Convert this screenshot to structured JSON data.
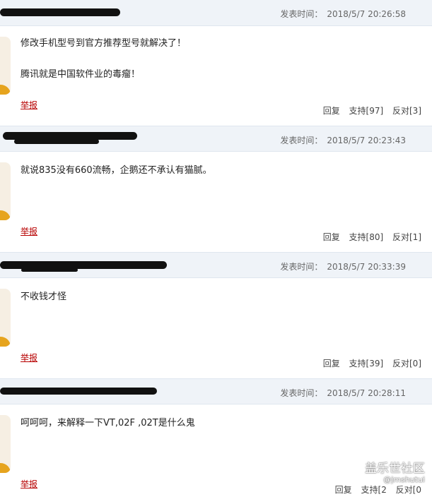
{
  "comments": [
    {
      "time_label": "发表时间：",
      "time": "2018/5/7 20:26:58",
      "line1": "修改手机型号到官方推荐型号就解决了！",
      "line2": "腾讯就是中国软件业的毒瘤！",
      "report": "举报",
      "reply": "回复",
      "support": "支持[97]",
      "oppose": "反对[3]"
    },
    {
      "time_label": "发表时间：",
      "time": "2018/5/7 20:23:43",
      "line1": "就说835没有660流畅，企鹅还不承认有猫腻。",
      "line2": "",
      "report": "举报",
      "reply": "回复",
      "support": "支持[80]",
      "oppose": "反对[1]"
    },
    {
      "time_label": "发表时间：",
      "time": "2018/5/7 20:33:39",
      "line1": "不收钱才怪",
      "line2": "",
      "report": "举报",
      "reply": "回复",
      "support": "支持[39]",
      "oppose": "反对[0]"
    },
    {
      "time_label": "发表时间：",
      "time": "2018/5/7 20:28:11",
      "line1": "呵呵呵，来解释一下VT,02F ,02T是什么鬼",
      "line2": "",
      "report": "举报",
      "reply": "回复",
      "support": "支持[2",
      "oppose": "反对[0"
    }
  ],
  "watermark": {
    "title": "盖乐世社区",
    "sub": "@jmshutui"
  },
  "colors": {
    "header_bg": "#eff3f8",
    "report_red": "#b70000",
    "avatar_accent": "#e6a41e"
  }
}
